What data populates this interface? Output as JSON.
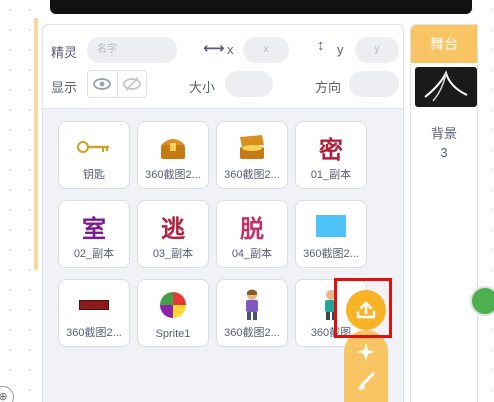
{
  "sprite_info": {
    "sprite_label": "精灵",
    "name_placeholder": "名字",
    "x_label": "x",
    "x_placeholder": "x",
    "y_label": "y",
    "y_placeholder": "y",
    "show_label": "显示",
    "size_label": "大小",
    "direction_label": "方向"
  },
  "sprites": [
    {
      "name": "钥匙",
      "icon": "key-icon"
    },
    {
      "name": "360截图2...",
      "icon": "treasure-chest-closed"
    },
    {
      "name": "360截图2...",
      "icon": "treasure-chest-open"
    },
    {
      "name": "01_副本",
      "icon": "hanzi",
      "char": "密"
    },
    {
      "name": "02_副本",
      "icon": "hanzi",
      "char": "室"
    },
    {
      "name": "03_副本",
      "icon": "hanzi",
      "char": "逃"
    },
    {
      "name": "04_副本",
      "icon": "hanzi",
      "char": "脱"
    },
    {
      "name": "360截图2...",
      "icon": "blue-rectangle"
    },
    {
      "name": "360截图2...",
      "icon": "sign-plate"
    },
    {
      "name": "Sprite1",
      "icon": "color-wheel"
    },
    {
      "name": "360截图2...",
      "icon": "character-figure"
    },
    {
      "name": "360截图",
      "icon": "character-figure-2"
    }
  ],
  "stage": {
    "tab_label": "舞台",
    "backdrop_label": "背景",
    "backdrop_count": "3"
  },
  "colors": {
    "accent_yellow": "#f9c463",
    "upload_orange": "#f9b327",
    "highlight_red": "#e01010",
    "text": "#575e75"
  }
}
